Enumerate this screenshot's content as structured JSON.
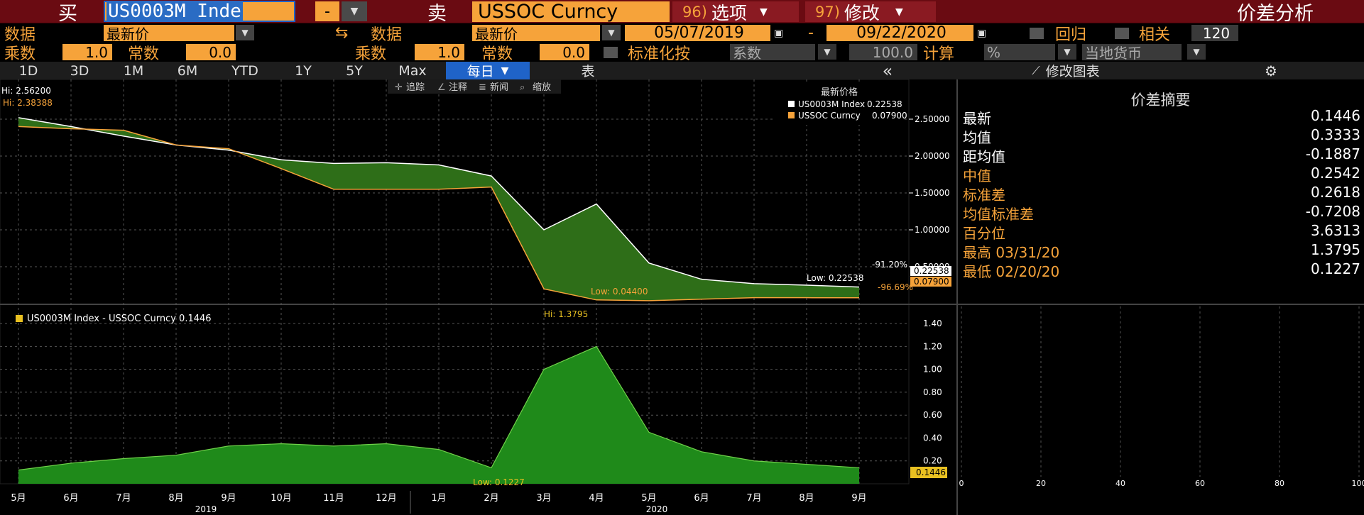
{
  "header": {
    "buy_label": "买",
    "buy_ticker": "US0003M Inde",
    "sell_label": "卖",
    "sell_ticker": "USSOC Curncy",
    "options_num": "96)",
    "options_label": "选项",
    "modify_num": "97)",
    "modify_label": "修改",
    "spread_label": "价差分析",
    "dash": "-"
  },
  "row2": {
    "data1_label": "数据",
    "data1_value": "最新价",
    "data2_label": "数据",
    "data2_value": "最新价",
    "date_from": "05/07/2019",
    "date_sep": "-",
    "date_to": "09/22/2020",
    "regress_label": "回归",
    "corr_label": "相关",
    "corr_value": "120"
  },
  "row3": {
    "mult1_label": "乘数",
    "mult1_value": "1.0",
    "const1_label": "常数",
    "const1_value": "0.0",
    "mult2_label": "乘数",
    "mult2_value": "1.0",
    "const2_label": "常数",
    "const2_value": "0.0",
    "normalize_label": "标准化按",
    "normalize_value": "系数",
    "normalize_num": "100.0",
    "calc_label": "计算",
    "calc_value": "%",
    "currency_value": "当地货币"
  },
  "tabs": {
    "periods": [
      "1D",
      "3D",
      "1M",
      "6M",
      "YTD",
      "1Y",
      "5Y",
      "Max"
    ],
    "freq": "每日",
    "table": "表",
    "collapse": "«",
    "edit_chart": "修改图表"
  },
  "toolbar": {
    "track": "追踪",
    "annotate": "注释",
    "news": "新闻",
    "zoom": "缩放"
  },
  "legend_top": {
    "title": "最新价格",
    "s1": "US0003M Index",
    "s1_val": "0.22538",
    "s2": "USSOC Curncy",
    "s2_val": "0.07900"
  },
  "legend_bottom": {
    "label": "US0003M Index - USSOC Curncy 0.1446"
  },
  "annotations": {
    "hi_top": "Hi: 2.56200",
    "hi_top2": "Hi: 2.38388",
    "low_top": "Low: 0.04400",
    "low_top2": "Low: 0.22538",
    "pct1": "-91.20%",
    "pct2": "-96.69%",
    "hi_bottom": "Hi: 1.3795",
    "low_bottom": "Low: 0.1227",
    "last_s1": "0.22538",
    "last_s2": "0.07900",
    "last_spread": "0.1446"
  },
  "summary": {
    "title": "价差摘要",
    "rows": [
      {
        "k": "最新",
        "v": "0.1446",
        "o": false
      },
      {
        "k": "均值",
        "v": "0.3333",
        "o": false
      },
      {
        "k": "距均值",
        "v": "-0.1887",
        "o": false
      },
      {
        "k": "中值",
        "v": "0.2542",
        "o": true
      },
      {
        "k": "标准差",
        "v": "0.2618",
        "o": true
      },
      {
        "k": "均值标准差",
        "v": "-0.7208",
        "o": true
      },
      {
        "k": "百分位",
        "v": "3.6313",
        "o": true
      },
      {
        "k": "最高 03/31/20",
        "v": "1.3795",
        "o": true
      },
      {
        "k": "最低 02/20/20",
        "v": "0.1227",
        "o": true
      }
    ]
  },
  "colors": {
    "green": "#2e8b1e",
    "orange": "#f6a33a",
    "white": "#ffffff",
    "yellow": "#e8c021",
    "bg": "#000000"
  },
  "chart_data": [
    {
      "type": "area",
      "x": [
        "5月",
        "6月",
        "7月",
        "8月",
        "9月",
        "10月",
        "11月",
        "12月",
        "1月",
        "2月",
        "3月",
        "4月",
        "5月",
        "6月",
        "7月",
        "8月",
        "9月"
      ],
      "years": [
        "2019",
        "2020"
      ],
      "series": [
        {
          "name": "US0003M Index",
          "values": [
            2.52,
            2.4,
            2.27,
            2.15,
            2.08,
            1.95,
            1.9,
            1.91,
            1.88,
            1.73,
            1.0,
            1.35,
            0.55,
            0.33,
            0.27,
            0.25,
            0.225
          ]
        },
        {
          "name": "USSOC Curncy",
          "values": [
            2.4,
            2.37,
            2.35,
            2.15,
            2.1,
            1.83,
            1.55,
            1.55,
            1.55,
            1.58,
            0.2,
            0.05,
            0.04,
            0.06,
            0.08,
            0.08,
            0.079
          ]
        }
      ],
      "ylim": [
        0,
        2.75
      ],
      "yticks": [
        "0.50000",
        "1.00000",
        "1.50000",
        "2.00000",
        "2.50000"
      ]
    },
    {
      "type": "area",
      "x": [
        "5月",
        "6月",
        "7月",
        "8月",
        "9月",
        "10月",
        "11月",
        "12月",
        "1月",
        "2月",
        "3月",
        "4月",
        "5月",
        "6月",
        "7月",
        "8月",
        "9月"
      ],
      "series": [
        {
          "name": "US0003M Index - USSOC Curncy",
          "values": [
            0.12,
            0.18,
            0.22,
            0.25,
            0.33,
            0.35,
            0.33,
            0.35,
            0.3,
            0.14,
            1.0,
            1.2,
            0.45,
            0.28,
            0.2,
            0.17,
            0.14
          ]
        }
      ],
      "ylim": [
        0,
        1.5
      ],
      "yticks": [
        "0.20",
        "0.40",
        "0.60",
        "0.80",
        "1.00",
        "1.20",
        "1.40"
      ]
    },
    {
      "type": "bar",
      "orientation": "horizontal",
      "xticks": [
        "0",
        "20",
        "40",
        "60",
        "80",
        "100"
      ],
      "xlim": [
        0,
        100
      ]
    }
  ]
}
